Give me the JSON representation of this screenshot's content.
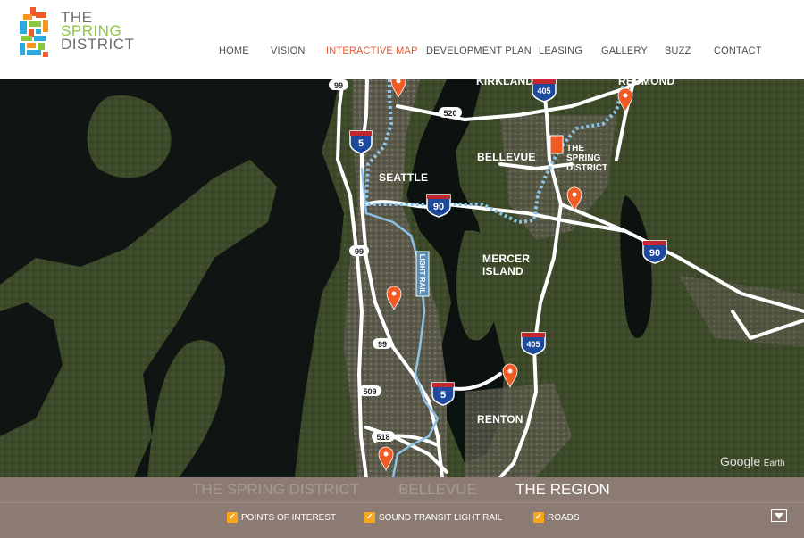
{
  "logo": {
    "line1": "THE",
    "line2": "SPRING",
    "line3": "DISTRICT",
    "brand_colors": [
      "#f15a24",
      "#8dc63f",
      "#29abe2",
      "#f7941d"
    ]
  },
  "nav": {
    "items": [
      {
        "label": "HOME",
        "active": false
      },
      {
        "label": "VISION",
        "active": false
      },
      {
        "label": "INTERACTIVE MAP",
        "active": true
      },
      {
        "label": "DEVELOPMENT PLAN",
        "active": false
      },
      {
        "label": "LEASING",
        "active": false
      },
      {
        "label": "GALLERY",
        "active": false
      },
      {
        "label": "BUZZ",
        "active": false
      },
      {
        "label": "CONTACT",
        "active": false
      }
    ],
    "active_color": "#e4572e"
  },
  "map": {
    "places": {
      "kirkland": "KIRKLAND",
      "redmond": "REDMOND",
      "bellevue": "BELLEVUE",
      "seattle": "SEATTLE",
      "mercer1": "MERCER",
      "mercer2": "ISLAND",
      "renton": "RENTON",
      "spring1": "THE",
      "spring2": "SPRING",
      "spring3": "DISTRICT"
    },
    "shields": {
      "i5_north": "5",
      "i5_south": "5",
      "i90_west": "90",
      "i90_east": "90",
      "i405_north": "405",
      "i405_south": "405",
      "sr99_a": "99",
      "sr99_b": "99",
      "sr99_c": "99",
      "sr520": "520",
      "sr509": "509",
      "sr518": "518"
    },
    "light_rail_label": "LIGHT RAIL",
    "attribution": {
      "google": "Google",
      "earth": "Earth"
    }
  },
  "tabs": {
    "items": [
      {
        "label": "THE SPRING DISTRICT",
        "active": false
      },
      {
        "label": "BELLEVUE",
        "active": false
      },
      {
        "label": "THE REGION",
        "active": true
      }
    ]
  },
  "layers": {
    "items": [
      {
        "label": "POINTS OF INTEREST",
        "checked": true
      },
      {
        "label": "SOUND TRANSIT LIGHT RAIL",
        "checked": true
      },
      {
        "label": "ROADS",
        "checked": true
      }
    ],
    "check_color": "#f7a51a"
  }
}
